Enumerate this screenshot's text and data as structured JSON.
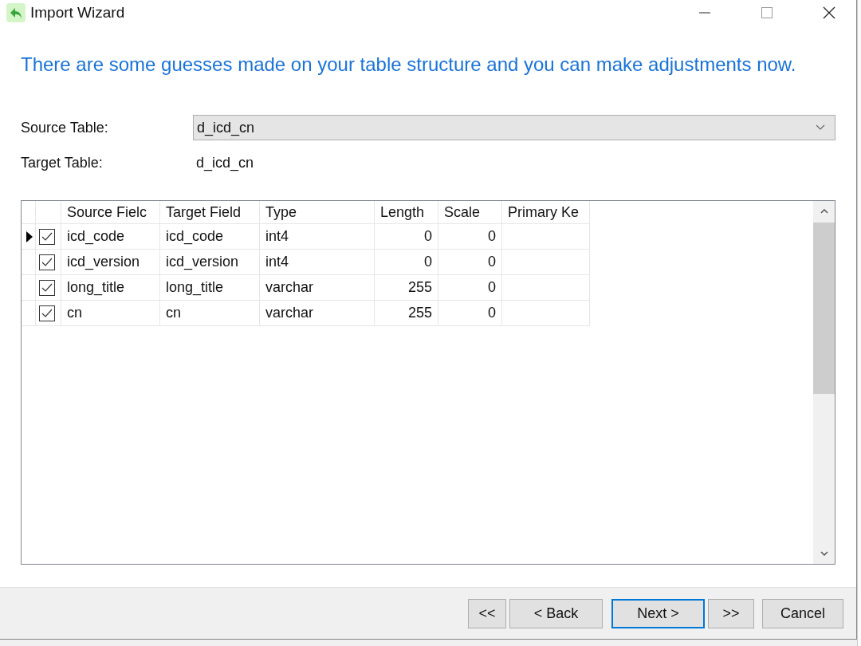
{
  "window": {
    "title": "Import Wizard"
  },
  "heading": "There are some guesses made on your table structure and you can make adjustments now.",
  "source_table": {
    "label": "Source Table:",
    "value": "d_icd_cn"
  },
  "target_table": {
    "label": "Target Table:",
    "value": "d_icd_cn"
  },
  "grid": {
    "columns": [
      "Source Fielc",
      "Target Field",
      "Type",
      "Length",
      "Scale",
      "Primary Ke"
    ],
    "rows": [
      {
        "current": true,
        "checked": true,
        "cells": [
          "icd_code",
          "icd_code",
          "int4",
          "0",
          "0"
        ]
      },
      {
        "current": false,
        "checked": true,
        "cells": [
          "icd_version",
          "icd_version",
          "int4",
          "0",
          "0"
        ]
      },
      {
        "current": false,
        "checked": true,
        "cells": [
          "long_title",
          "long_title",
          "varchar",
          "255",
          "0"
        ]
      },
      {
        "current": false,
        "checked": true,
        "cells": [
          "cn",
          "cn",
          "varchar",
          "255",
          "0"
        ]
      }
    ]
  },
  "buttons": [
    {
      "label": "<<",
      "default": false
    },
    {
      "label": "< Back",
      "default": false
    },
    {
      "label": "Next >",
      "default": true
    },
    {
      "label": ">>",
      "default": false
    },
    {
      "label": "Cancel",
      "default": false
    }
  ]
}
